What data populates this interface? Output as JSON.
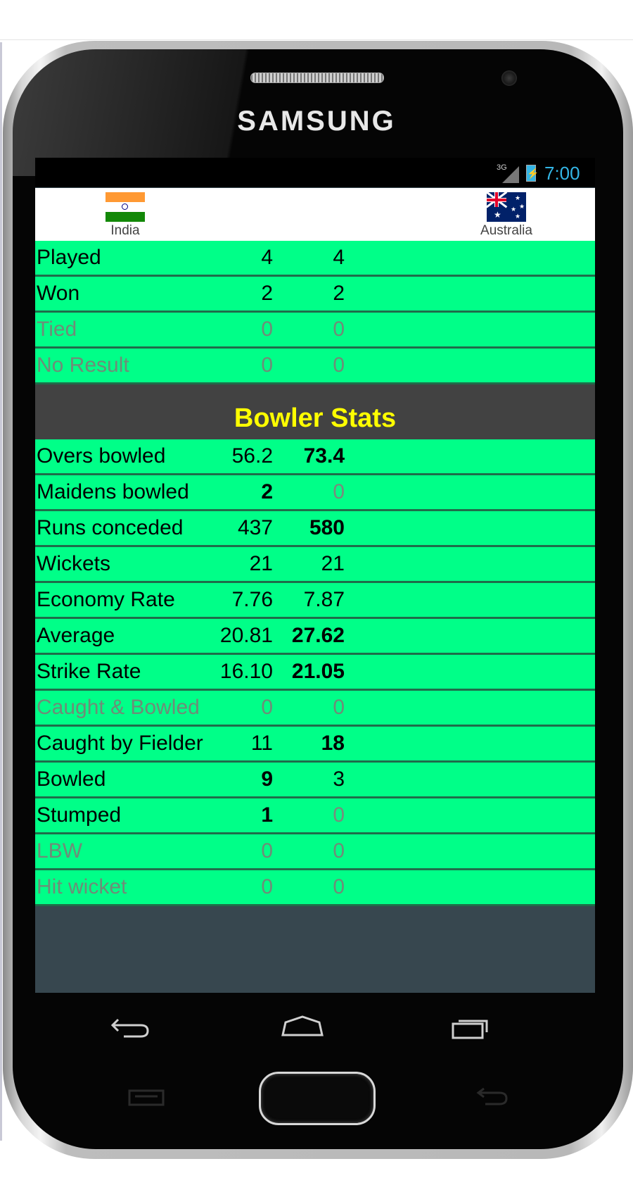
{
  "device": {
    "brand": "SAMSUNG"
  },
  "status_bar": {
    "network": "3G",
    "time": "7:00",
    "accent_color": "#33b5e5"
  },
  "teams": {
    "team1": {
      "name": "India",
      "flag_icon": "india-flag-icon"
    },
    "team2": {
      "name": "Australia",
      "flag_icon": "australia-flag-icon"
    }
  },
  "colors": {
    "row_background": "#00ff88",
    "section_background": "#424242",
    "section_title": "#ffff00"
  },
  "match_stats": [
    {
      "label": "Played",
      "v1": "4",
      "v2": "4"
    },
    {
      "label": "Won",
      "v1": "2",
      "v2": "2"
    },
    {
      "label": "Tied",
      "v1": "0",
      "v2": "0"
    },
    {
      "label": "No Result",
      "v1": "0",
      "v2": "0"
    }
  ],
  "bowler_section": {
    "title": "Bowler Stats"
  },
  "bowler_stats": [
    {
      "label": "Overs bowled",
      "v1": "56.2",
      "v2": "73.4"
    },
    {
      "label": "Maidens bowled",
      "v1": "2",
      "v2": "0"
    },
    {
      "label": "Runs conceded",
      "v1": "437",
      "v2": "580"
    },
    {
      "label": "Wickets",
      "v1": "21",
      "v2": "21"
    },
    {
      "label": "Economy Rate",
      "v1": "7.76",
      "v2": "7.87"
    },
    {
      "label": "Average",
      "v1": "20.81",
      "v2": "27.62"
    },
    {
      "label": "Strike Rate",
      "v1": "16.10",
      "v2": "21.05"
    },
    {
      "label": "Caught & Bowled",
      "v1": "0",
      "v2": "0"
    },
    {
      "label": "Caught by Fielder",
      "v1": "11",
      "v2": "18"
    },
    {
      "label": "Bowled",
      "v1": "9",
      "v2": "3"
    },
    {
      "label": "Stumped",
      "v1": "1",
      "v2": "0"
    },
    {
      "label": "LBW",
      "v1": "0",
      "v2": "0"
    },
    {
      "label": "Hit wicket",
      "v1": "0",
      "v2": "0"
    }
  ],
  "nav": {
    "back_icon": "back-icon",
    "home_icon": "home-icon",
    "recents_icon": "recents-icon"
  }
}
